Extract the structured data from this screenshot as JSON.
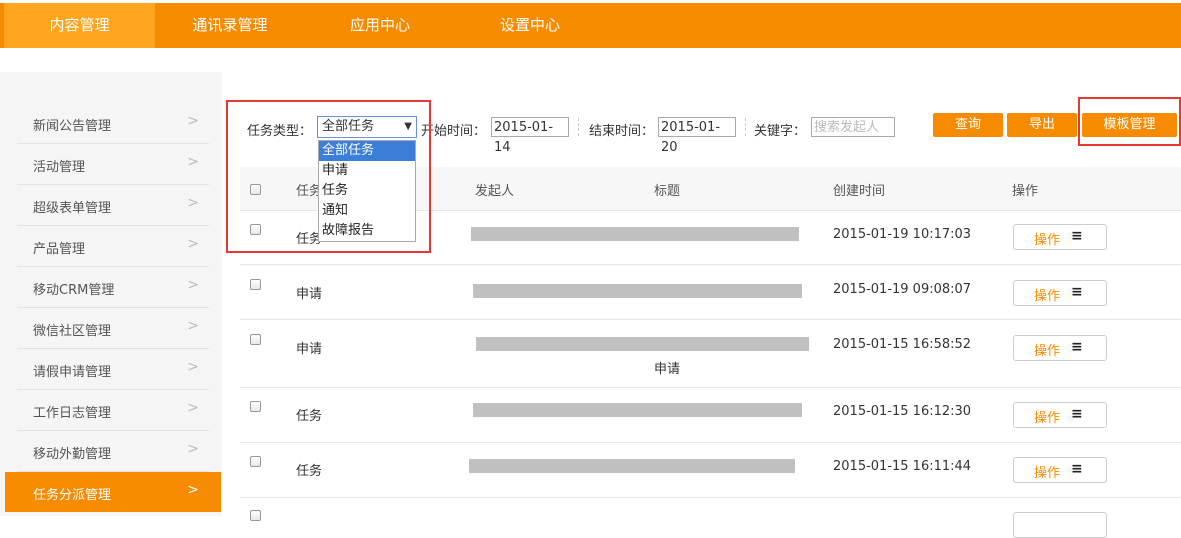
{
  "topnav": {
    "tabs": [
      {
        "label": "内容管理",
        "active": true
      },
      {
        "label": "通讯录管理",
        "active": false
      },
      {
        "label": "应用中心",
        "active": false
      },
      {
        "label": "设置中心",
        "active": false
      }
    ]
  },
  "sidebar": {
    "items": [
      {
        "label": "新闻公告管理"
      },
      {
        "label": "活动管理"
      },
      {
        "label": "超级表单管理"
      },
      {
        "label": "产品管理"
      },
      {
        "label": "移动CRM管理"
      },
      {
        "label": "微信社区管理"
      },
      {
        "label": "请假申请管理"
      },
      {
        "label": "工作日志管理"
      },
      {
        "label": "移动外勤管理"
      },
      {
        "label": "任务分派管理",
        "active": true
      }
    ],
    "chevron": ">"
  },
  "filters": {
    "task_type_label": "任务类型：",
    "task_type_value": "全部任务",
    "task_type_options": [
      "全部任务",
      "申请",
      "任务",
      "通知",
      "故障报告"
    ],
    "start_label": "开始时间：",
    "start_value": "2015-01-14",
    "end_label": "结束时间：",
    "end_value": "2015-01-20",
    "keyword_label": "关键字：",
    "keyword_placeholder": "搜索发起人"
  },
  "buttons": {
    "query": "查询",
    "export": "导出",
    "template": "模板管理"
  },
  "table": {
    "headers": [
      "任务",
      "发起人",
      "标题",
      "创建时间",
      "操作"
    ],
    "rows": [
      {
        "type": "任务",
        "title_extra": "",
        "created": "2015-01-19 10:17:03",
        "op": "操作"
      },
      {
        "type": "申请",
        "title_extra": "",
        "created": "2015-01-19 09:08:07",
        "op": "操作"
      },
      {
        "type": "申请",
        "title_extra": "申请",
        "created": "2015-01-15 16:58:52",
        "op": "操作"
      },
      {
        "type": "任务",
        "title_extra": "",
        "created": "2015-01-15 16:12:30",
        "op": "操作"
      },
      {
        "type": "任务",
        "title_extra": "",
        "created": "2015-01-15 16:11:44",
        "op": "操作"
      }
    ]
  },
  "colors": {
    "accent": "#f78b00",
    "accent_light": "#ffa51f",
    "highlight_box": "#e53935",
    "dropdown_selected": "#3c7fd9"
  },
  "icons": {
    "menu": "menu-icon",
    "chevron": "chevron-right-icon"
  }
}
